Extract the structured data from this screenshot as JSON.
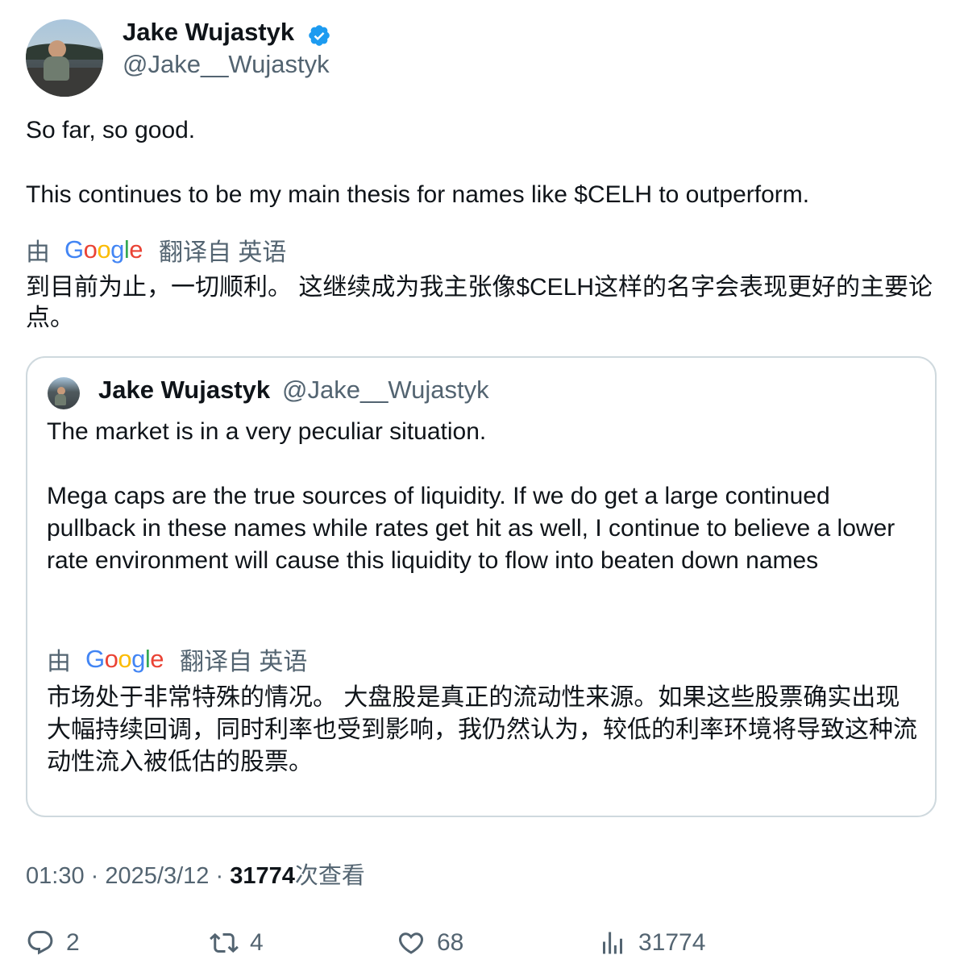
{
  "author": {
    "name": "Jake Wujastyk",
    "handle": "@Jake__Wujastyk"
  },
  "tweet": {
    "line1": "So far, so good.",
    "line2": "This continues to be my main thesis for names like $CELH to outperform."
  },
  "translation": {
    "by": "由",
    "google_letters": [
      "G",
      "o",
      "o",
      "g",
      "l",
      "e"
    ],
    "from": "翻译自 英语",
    "text": "到目前为止，一切顺利。 这继续成为我主张像$CELH这样的名字会表现更好的主要论点。"
  },
  "quote": {
    "name": "Jake Wujastyk",
    "handle": "@Jake__Wujastyk",
    "line1": "The market is in a very peculiar situation.",
    "line2": "Mega caps are the true sources of liquidity. If we do get a large continued pullback in these names while rates get hit as well, I continue to believe a lower rate environment will cause this liquidity to flow into beaten down names",
    "translation_by": "由",
    "translation_from": "翻译自 英语",
    "translation_text": "市场处于非常特殊的情况。 大盘股是真正的流动性来源。如果这些股票确实出现大幅持续回调，同时利率也受到影响，我仍然认为，较低的利率环境将导致这种流动性流入被低估的股票。"
  },
  "meta": {
    "time": "01:30",
    "sep": "·",
    "date": "2025/3/12",
    "views": "31774",
    "views_label": "次查看"
  },
  "actions": {
    "replies": "2",
    "retweets": "4",
    "likes": "68",
    "views": "31774"
  },
  "colors": {
    "verified": "#1d9bf0",
    "secondary_text": "#536471",
    "border": "#cfd9de"
  }
}
